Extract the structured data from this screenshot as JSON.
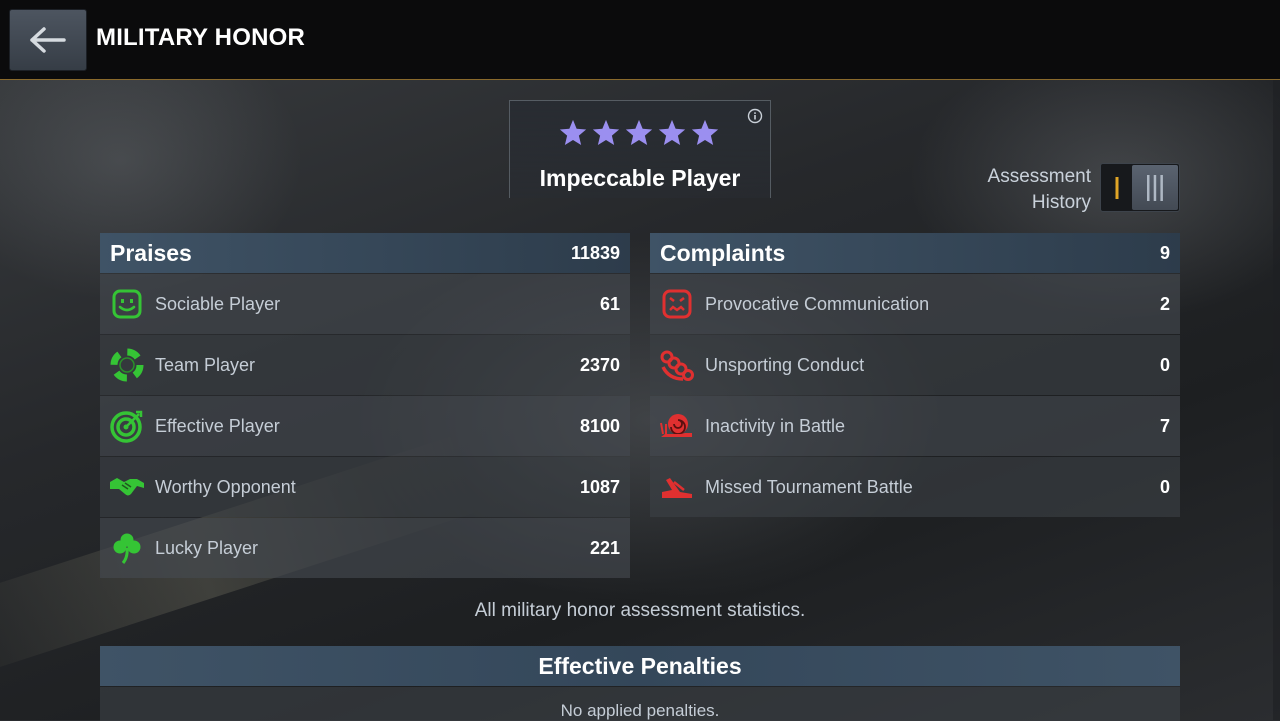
{
  "header": {
    "title": "MILITARY HONOR",
    "back_icon": "arrow-left-icon"
  },
  "rating": {
    "stars_filled": 5,
    "stars_total": 5,
    "star_color": "#9b8ff0",
    "title": "Impeccable Player",
    "info_icon": "info-icon"
  },
  "history": {
    "label_line1": "Assessment",
    "label_line2": "History",
    "active_option": "III"
  },
  "praises": {
    "title": "Praises",
    "total": "11839",
    "items": [
      {
        "label": "Sociable Player",
        "value": "61",
        "icon": "smiley-face-icon"
      },
      {
        "label": "Team Player",
        "value": "2370",
        "icon": "lifebuoy-icon"
      },
      {
        "label": "Effective Player",
        "value": "8100",
        "icon": "target-icon"
      },
      {
        "label": "Worthy Opponent",
        "value": "1087",
        "icon": "handshake-icon"
      },
      {
        "label": "Lucky Player",
        "value": "221",
        "icon": "clover-icon"
      }
    ]
  },
  "complaints": {
    "title": "Complaints",
    "total": "9",
    "items": [
      {
        "label": "Provocative Communication",
        "value": "2",
        "icon": "angry-face-icon"
      },
      {
        "label": "Unsporting Conduct",
        "value": "0",
        "icon": "brass-knuckles-icon"
      },
      {
        "label": "Inactivity in Battle",
        "value": "7",
        "icon": "snail-icon"
      },
      {
        "label": "Missed Tournament Battle",
        "value": "0",
        "icon": "missed-battle-icon"
      }
    ]
  },
  "footnote": "All military honor assessment statistics.",
  "penalties": {
    "title": "Effective Penalties",
    "empty_text": "No applied penalties."
  },
  "colors": {
    "praise_green": "#35c435",
    "complaint_red": "#e03030",
    "header_accent": "#8a6a2c"
  }
}
